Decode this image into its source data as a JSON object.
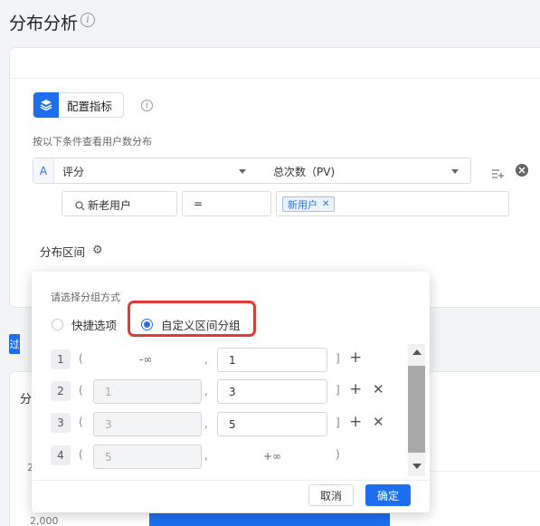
{
  "header": {
    "title": "分布分析"
  },
  "config": {
    "button_label": "配置指标",
    "condition_caption": "按以下条件查看用户数分布",
    "metric": {
      "letter": "A",
      "event": "评分",
      "measure": "总次数（PV)"
    },
    "filter": {
      "property": "新老用户",
      "operator": "=",
      "value_tag": "新用户"
    },
    "distribution_label": "分布区间"
  },
  "popup": {
    "caption": "请选择分组方式",
    "options": [
      {
        "label": "快捷选项",
        "selected": false
      },
      {
        "label": "自定义区间分组",
        "selected": true
      }
    ],
    "rows": [
      {
        "index": "1",
        "from": "-∞",
        "to": "1",
        "close": "]"
      },
      {
        "index": "2",
        "from": "1",
        "to": "3",
        "close": "]"
      },
      {
        "index": "3",
        "from": "3",
        "to": "5",
        "close": "]"
      },
      {
        "index": "4",
        "from": "5",
        "to": "+∞",
        "close": ")"
      }
    ],
    "open_paren": "(",
    "comma": ",",
    "cancel_label": "取消",
    "confirm_label": "确定"
  },
  "background": {
    "tab_partial": "过",
    "section_partial": "分",
    "axis_label_top": "2",
    "axis_label_bottom": "2,000"
  },
  "colors": {
    "accent": "#1e6ff0",
    "highlight": "#e53935"
  }
}
